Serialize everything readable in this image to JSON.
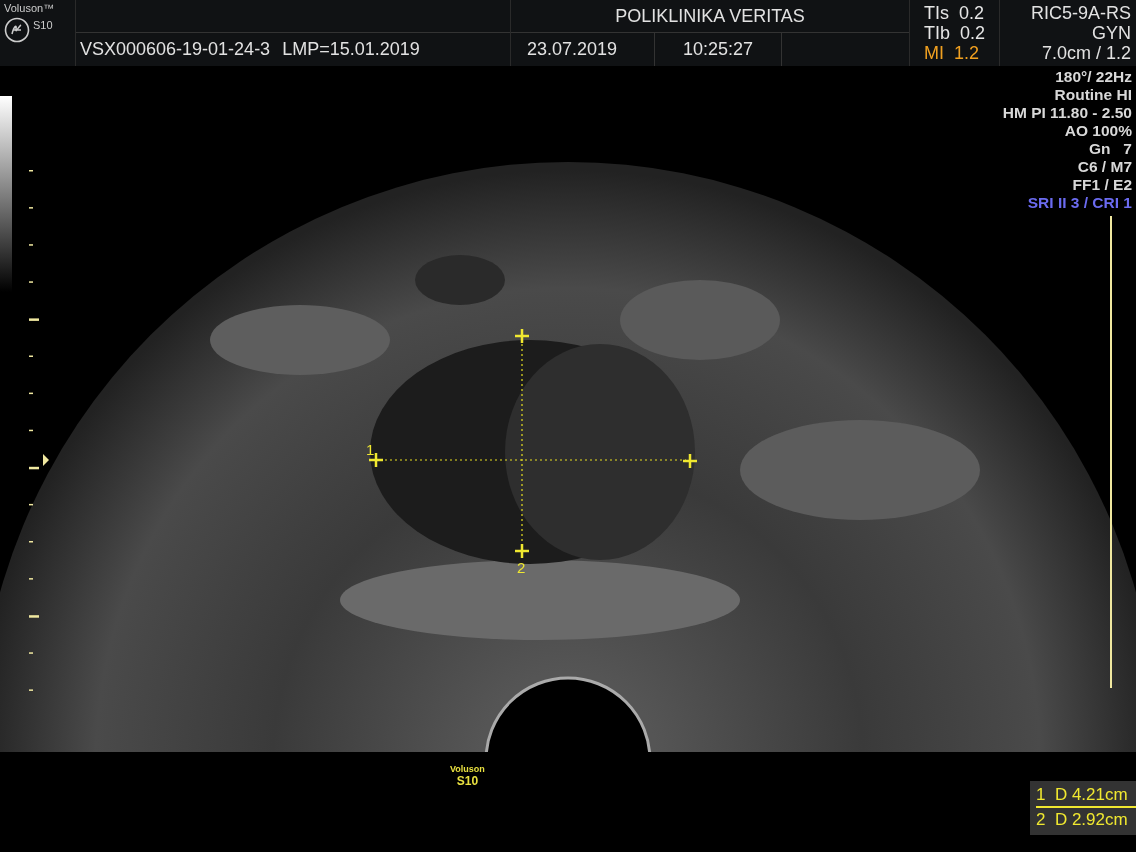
{
  "header": {
    "brand": "Voluson™",
    "model": "S10",
    "patient_id": "VSX000606-19-01-24-3",
    "lmp": "LMP=15.01.2019",
    "clinic": "POLIKLINIKA VERITAS",
    "date": "23.07.2019",
    "time": "10:25:27",
    "indices": [
      {
        "label": "TIs",
        "value": "0.2",
        "kind": "normal"
      },
      {
        "label": "TIb",
        "value": "0.2",
        "kind": "normal"
      },
      {
        "label": "MI",
        "value": "1.2",
        "kind": "warning"
      }
    ],
    "probe": "RIC5-9A-RS",
    "preset": "GYN",
    "depth": "7.0cm / 1.2"
  },
  "parameters": [
    {
      "text": "180°/ 22Hz",
      "kind": "normal"
    },
    {
      "text": "Routine HI",
      "kind": "normal"
    },
    {
      "text": "HM PI 11.80 - 2.50",
      "kind": "normal"
    },
    {
      "text": "AO 100%",
      "kind": "normal"
    },
    {
      "text": "Gn   7",
      "kind": "normal"
    },
    {
      "text": "C6 / M7",
      "kind": "normal"
    },
    {
      "text": "FF1 / E2",
      "kind": "normal"
    },
    {
      "text": "SRI II 3 / CRI 1",
      "kind": "accent"
    }
  ],
  "calipers": [
    {
      "label": "1"
    },
    {
      "label": "2"
    }
  ],
  "footer_logo": {
    "brand": "Voluson",
    "model": "S10"
  },
  "measurements": [
    {
      "index": "1",
      "text": "D 4.21cm",
      "selected": true
    },
    {
      "index": "2",
      "text": "D 2.92cm",
      "selected": false
    }
  ]
}
